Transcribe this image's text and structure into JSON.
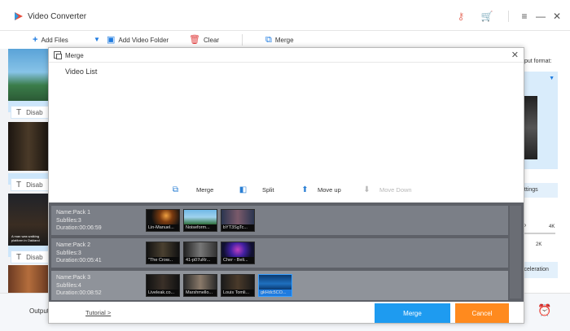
{
  "app": {
    "title": "Video Converter"
  },
  "toolbar": {
    "add_files": "Add Files",
    "add_video_folder": "Add Video Folder",
    "clear": "Clear",
    "merge": "Merge"
  },
  "background": {
    "disable_label": "Disab",
    "caption_text": "A man was walking\nplatform in Oakland",
    "output_format_label": "tput format:",
    "settings_label": "ettings",
    "acceleration_label": "cceleration",
    "output_label": "Output",
    "res_4k": "4K",
    "res_2k": "2K",
    "res_p": "P"
  },
  "dialog": {
    "title": "Merge",
    "video_list_label": "Video List",
    "actions": {
      "merge": "Merge",
      "split": "Split",
      "move_up": "Move up",
      "move_down": "Move Down"
    },
    "packs": [
      {
        "name": "Name:Pack 1",
        "subfiles": "Subfiles:3",
        "duration": "Duration:00:06:59",
        "files": [
          "Lin-Manuel...",
          "Noiseform...",
          "bYT3SgTc..."
        ]
      },
      {
        "name": "Name:Pack 2",
        "subfiles": "Subfiles:3",
        "duration": "Duration:00:05:41",
        "files": [
          "\"The Crow...",
          "41-p07uRr...",
          "Cher - Beli..."
        ]
      },
      {
        "name": "Name:Pack 3",
        "subfiles": "Subfiles:4",
        "duration": "Duration:00:08:52",
        "files": [
          "Liveleak.co...",
          "Marshmello...",
          "Louis Tomli...",
          "gkHdc5CO..."
        ]
      }
    ],
    "footer": {
      "tutorial": "Tutorial >",
      "merge_button": "Merge",
      "cancel_button": "Cancel"
    }
  },
  "colors": {
    "accent_blue": "#1e9bf0",
    "cancel_orange": "#ff8a1e",
    "pack_bg": "#5e6168"
  }
}
